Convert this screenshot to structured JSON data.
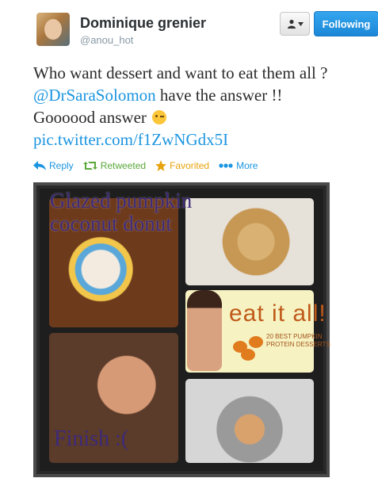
{
  "user": {
    "name": "Dominique grenier",
    "handle": "@anou_hot"
  },
  "header": {
    "follow_label": "Following",
    "user_menu_icon": "person-dropdown-icon"
  },
  "tweet": {
    "line1": "Who want dessert and want to eat them all ?",
    "mention": "@DrSaraSolomon",
    "line2_rest": " have the answer !!",
    "line3": "Goooood answer",
    "emoji": "winking-face-icon",
    "link": "pic.twitter.com/f1ZwNGdx5I"
  },
  "actions": {
    "reply": "Reply",
    "retweeted": "Retweeted",
    "favorited": "Favorited",
    "more": "More"
  },
  "photo": {
    "overlay_line1": "Glazed pumpkin",
    "overlay_line2": "coconut donut",
    "overlay_finish": "Finish :(",
    "cover_title": "eat it all!",
    "cover_subtitle": "20 BEST PUMPKIN PROTEIN DESSERTS"
  },
  "colors": {
    "link": "#1b95e0",
    "follow_button": "#1c87d8",
    "retweet": "#5aa83a",
    "favorite": "#e6a30b"
  }
}
